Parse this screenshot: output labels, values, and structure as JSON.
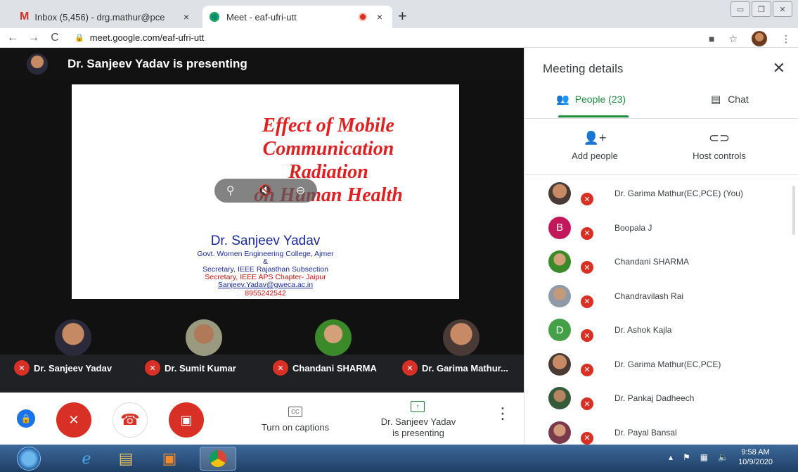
{
  "browser": {
    "tabs": [
      {
        "title": "Inbox (5,456) - drg.mathur@pce"
      },
      {
        "title": "Meet - eaf-ufri-utt"
      }
    ],
    "url": "meet.google.com/eaf-ufri-utt",
    "icons": {
      "back": "←",
      "forward": "→",
      "reload": "C",
      "close": "×",
      "new_tab": "+",
      "star": "☆",
      "menu": "⋮"
    }
  },
  "meet": {
    "presenting_banner": "Dr. Sanjeev Yadav is presenting",
    "slide": {
      "title_lines": [
        "Effect of Mobile",
        "Communication",
        "Radiation",
        "on Human Health"
      ],
      "author": "Dr. Sanjeev Yadav",
      "lines": [
        {
          "text": "Govt. Women Engineering College, Ajmer",
          "color": "#1a2a9a"
        },
        {
          "text": "&",
          "color": "#1a2a9a"
        },
        {
          "text": "Secretary, IEEE Rajasthan Subsection",
          "color": "#1a2a9a"
        },
        {
          "text": "Secretary, IEEE APS Chapter- Jaipur",
          "color": "#d01010"
        },
        {
          "text": "Sanjeev.Yadav@gweca.ac.in",
          "color": "#1a2a9a"
        },
        {
          "text": "8955242542",
          "color": "#d01010"
        }
      ]
    },
    "tiles": [
      {
        "name": "Dr. Sanjeev Yadav"
      },
      {
        "name": "Dr. Sumit Kumar"
      },
      {
        "name": "Chandani SHARMA"
      },
      {
        "name": "Dr. Garima Mathur..."
      }
    ],
    "controls": {
      "captions_label": "Turn on captions",
      "presenting_line1": "Dr. Sanjeev Yadav",
      "presenting_line2": "is presenting"
    }
  },
  "panel": {
    "title": "Meeting details",
    "tab_people": "People (23)",
    "tab_chat": "Chat",
    "add_people": "Add people",
    "host_controls": "Host controls",
    "people": [
      {
        "name": "Dr. Garima Mathur(EC,PCE) (You)",
        "avatar": "photo",
        "initial": ""
      },
      {
        "name": "Boopala J",
        "avatar": "letter",
        "initial": "B",
        "color": "#c2185b"
      },
      {
        "name": "Chandani SHARMA",
        "avatar": "photo",
        "initial": ""
      },
      {
        "name": "Chandravilash Rai",
        "avatar": "photo",
        "initial": ""
      },
      {
        "name": "Dr. Ashok Kajla",
        "avatar": "letter",
        "initial": "D",
        "color": "#43a047"
      },
      {
        "name": "Dr. Garima Mathur(EC,PCE)",
        "avatar": "photo",
        "initial": ""
      },
      {
        "name": "Dr. Pankaj Dadheech",
        "avatar": "photo",
        "initial": ""
      },
      {
        "name": "Dr. Payal Bansal",
        "avatar": "photo",
        "initial": ""
      }
    ]
  },
  "taskbar": {
    "time": "9:58 AM",
    "date": "10/9/2020"
  }
}
